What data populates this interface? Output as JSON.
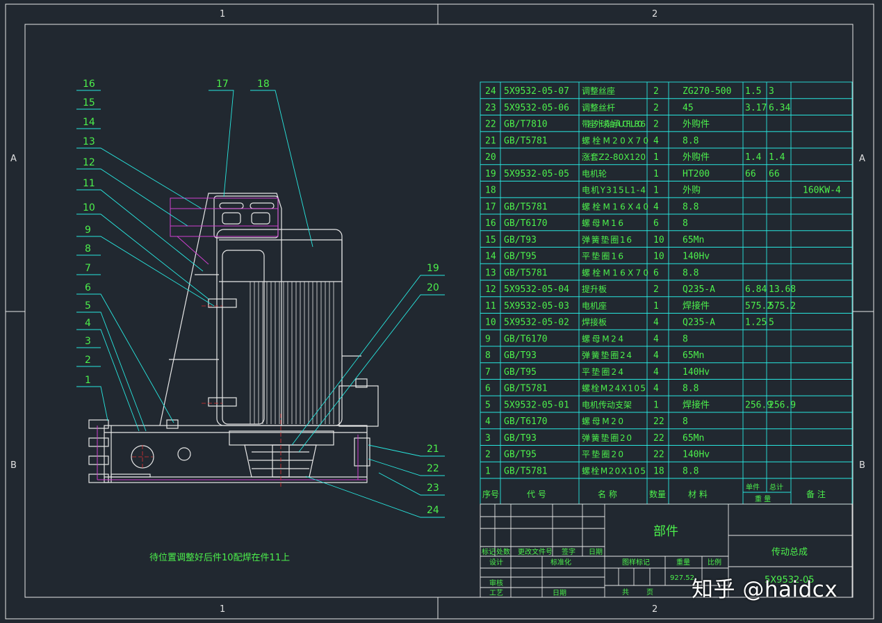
{
  "zone_labels": {
    "top_1": "1",
    "top_2": "2",
    "bottom_1": "1",
    "bottom_2": "2",
    "left_A": "A",
    "left_B": "B",
    "right_A": "A",
    "right_B": "B"
  },
  "balloons_left": [
    "16",
    "15",
    "14",
    "13",
    "12",
    "11",
    "10",
    "9",
    "8",
    "7",
    "6",
    "5",
    "4",
    "3",
    "2",
    "1"
  ],
  "balloons_top": [
    "17",
    "18"
  ],
  "balloons_right": [
    "19",
    "20",
    "21",
    "22",
    "23",
    "24"
  ],
  "bom": [
    {
      "no": "24",
      "code": "5X9532-05-07",
      "name": "调整丝座",
      "qty": "2",
      "material": "ZG270-500",
      "unit_wt": "1.5",
      "total_wt": "3",
      "note": ""
    },
    {
      "no": "23",
      "code": "5X9532-05-06",
      "name": "调整丝杆",
      "qty": "2",
      "material": "45",
      "unit_wt": "3.17",
      "total_wt": "6.34",
      "note": ""
    },
    {
      "no": "22",
      "code": "GB/T7810",
      "name": "带座外球轴承UCFLU306",
      "qty": "2",
      "material": "外购件",
      "unit_wt": "",
      "total_wt": "",
      "note": ""
    },
    {
      "no": "21",
      "code": "GB/T5781",
      "name": "螺栓M20X70",
      "qty": "4",
      "material": "8.8",
      "unit_wt": "",
      "total_wt": "",
      "note": ""
    },
    {
      "no": "20",
      "code": "",
      "name": "涨套Z2-80X120",
      "qty": "1",
      "material": "外购件",
      "unit_wt": "1.4",
      "total_wt": "1.4",
      "note": ""
    },
    {
      "no": "19",
      "code": "5X9532-05-05",
      "name": "电机轮",
      "qty": "1",
      "material": "HT200",
      "unit_wt": "66",
      "total_wt": "66",
      "note": ""
    },
    {
      "no": "18",
      "code": "",
      "name": "电机Y315L1-4",
      "qty": "1",
      "material": "外购",
      "unit_wt": "",
      "total_wt": "",
      "note": "160KW-4"
    },
    {
      "no": "17",
      "code": "GB/T5781",
      "name": "螺栓M16X40",
      "qty": "4",
      "material": "8.8",
      "unit_wt": "",
      "total_wt": "",
      "note": ""
    },
    {
      "no": "16",
      "code": "GB/T6170",
      "name": "螺母M16",
      "qty": "6",
      "material": "8",
      "unit_wt": "",
      "total_wt": "",
      "note": ""
    },
    {
      "no": "15",
      "code": "GB/T93",
      "name": "弹簧垫圈16",
      "qty": "10",
      "material": "65Mn",
      "unit_wt": "",
      "total_wt": "",
      "note": ""
    },
    {
      "no": "14",
      "code": "GB/T95",
      "name": "平垫圈16",
      "qty": "10",
      "material": "140Hv",
      "unit_wt": "",
      "total_wt": "",
      "note": ""
    },
    {
      "no": "13",
      "code": "GB/T5781",
      "name": "螺栓M16X70",
      "qty": "6",
      "material": "8.8",
      "unit_wt": "",
      "total_wt": "",
      "note": ""
    },
    {
      "no": "12",
      "code": "5X9532-05-04",
      "name": "提升板",
      "qty": "2",
      "material": "Q235-A",
      "unit_wt": "6.84",
      "total_wt": "13.68",
      "note": ""
    },
    {
      "no": "11",
      "code": "5X9532-05-03",
      "name": "电机座",
      "qty": "1",
      "material": "焊接件",
      "unit_wt": "575.2",
      "total_wt": "575.2",
      "note": ""
    },
    {
      "no": "10",
      "code": "5X9532-05-02",
      "name": "焊接板",
      "qty": "4",
      "material": "Q235-A",
      "unit_wt": "1.25",
      "total_wt": "5",
      "note": ""
    },
    {
      "no": "9",
      "code": "GB/T6170",
      "name": "螺母M24",
      "qty": "4",
      "material": "8",
      "unit_wt": "",
      "total_wt": "",
      "note": ""
    },
    {
      "no": "8",
      "code": "GB/T93",
      "name": "弹簧垫圈24",
      "qty": "4",
      "material": "65Mn",
      "unit_wt": "",
      "total_wt": "",
      "note": ""
    },
    {
      "no": "7",
      "code": "GB/T95",
      "name": "平垫圈24",
      "qty": "4",
      "material": "140Hv",
      "unit_wt": "",
      "total_wt": "",
      "note": ""
    },
    {
      "no": "6",
      "code": "GB/T5781",
      "name": "螺栓M24X105",
      "qty": "4",
      "material": "8.8",
      "unit_wt": "",
      "total_wt": "",
      "note": ""
    },
    {
      "no": "5",
      "code": "5X9532-05-01",
      "name": "电机传动支架",
      "qty": "1",
      "material": "焊接件",
      "unit_wt": "256.9",
      "total_wt": "256.9",
      "note": ""
    },
    {
      "no": "4",
      "code": "GB/T6170",
      "name": "螺母M20",
      "qty": "22",
      "material": "8",
      "unit_wt": "",
      "total_wt": "",
      "note": ""
    },
    {
      "no": "3",
      "code": "GB/T93",
      "name": "弹簧垫圈20",
      "qty": "22",
      "material": "65Mn",
      "unit_wt": "",
      "total_wt": "",
      "note": ""
    },
    {
      "no": "2",
      "code": "GB/T95",
      "name": "平垫圈20",
      "qty": "22",
      "material": "140Hv",
      "unit_wt": "",
      "total_wt": "",
      "note": ""
    },
    {
      "no": "1",
      "code": "GB/T5781",
      "name": "螺栓M20X105",
      "qty": "18",
      "material": "8.8",
      "unit_wt": "",
      "total_wt": "",
      "note": ""
    }
  ],
  "bom_header": {
    "no": "序号",
    "code": "代 号",
    "name": "名 称",
    "qty": "数量",
    "material": "材 料",
    "unit": "单件",
    "total": "总计",
    "weight": "重 量",
    "note": "备 注"
  },
  "title_block": {
    "part_type": "部件",
    "assembly_name": "传动总成",
    "mark": "标记",
    "count": "处数",
    "change_doc": "更改文件号",
    "signature": "签字",
    "date": "日期",
    "designer": "设计",
    "standardization": "标准化",
    "stage_mark": "图样标记",
    "weight": "重量",
    "scale": "比例",
    "weight_value": "927.52",
    "reviewer": "审核",
    "process": "工艺",
    "date2": "日期",
    "sheets_total": "共",
    "sheet": "页",
    "drawing_no_partial": "5X9532-05"
  },
  "note_text": "待位置调整好后件10配焊在件11上",
  "watermark": "知乎 @haidcx",
  "colors": {
    "background": "#212830",
    "line": "#e8e8e8",
    "text": "#4cf04c",
    "table_line": "#28e8e0",
    "accent": "#d040d0"
  }
}
